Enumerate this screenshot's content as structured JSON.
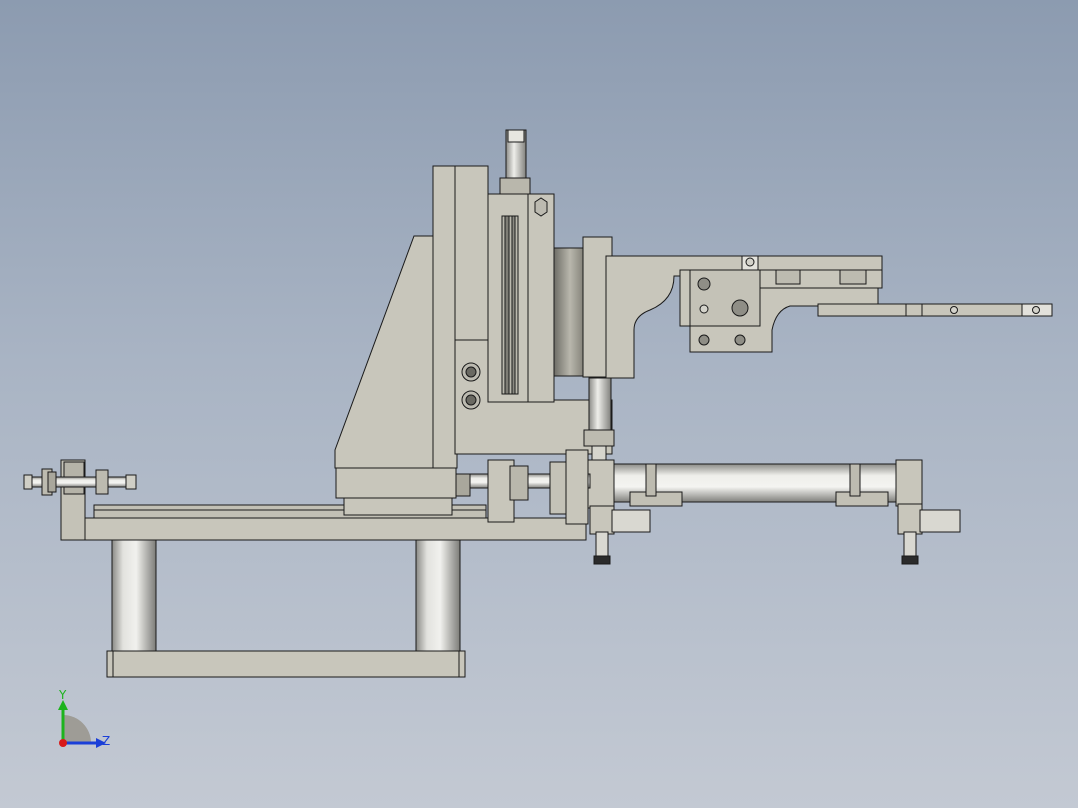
{
  "viewport": {
    "background_top": "#8c9bb0",
    "background_bottom": "#c3c9d3"
  },
  "model": {
    "part_color": "#c8c6bb",
    "shade_color": "#9e9c92",
    "edge_color": "#1a1a1a",
    "metal_color": "#d7d7d7",
    "dark_color": "#2b2b2b"
  },
  "triad": {
    "y_label": "Y",
    "z_label": "Z",
    "y_color": "#1db31d",
    "z_color": "#1a3fd8",
    "x_color": "#d81a1a"
  }
}
